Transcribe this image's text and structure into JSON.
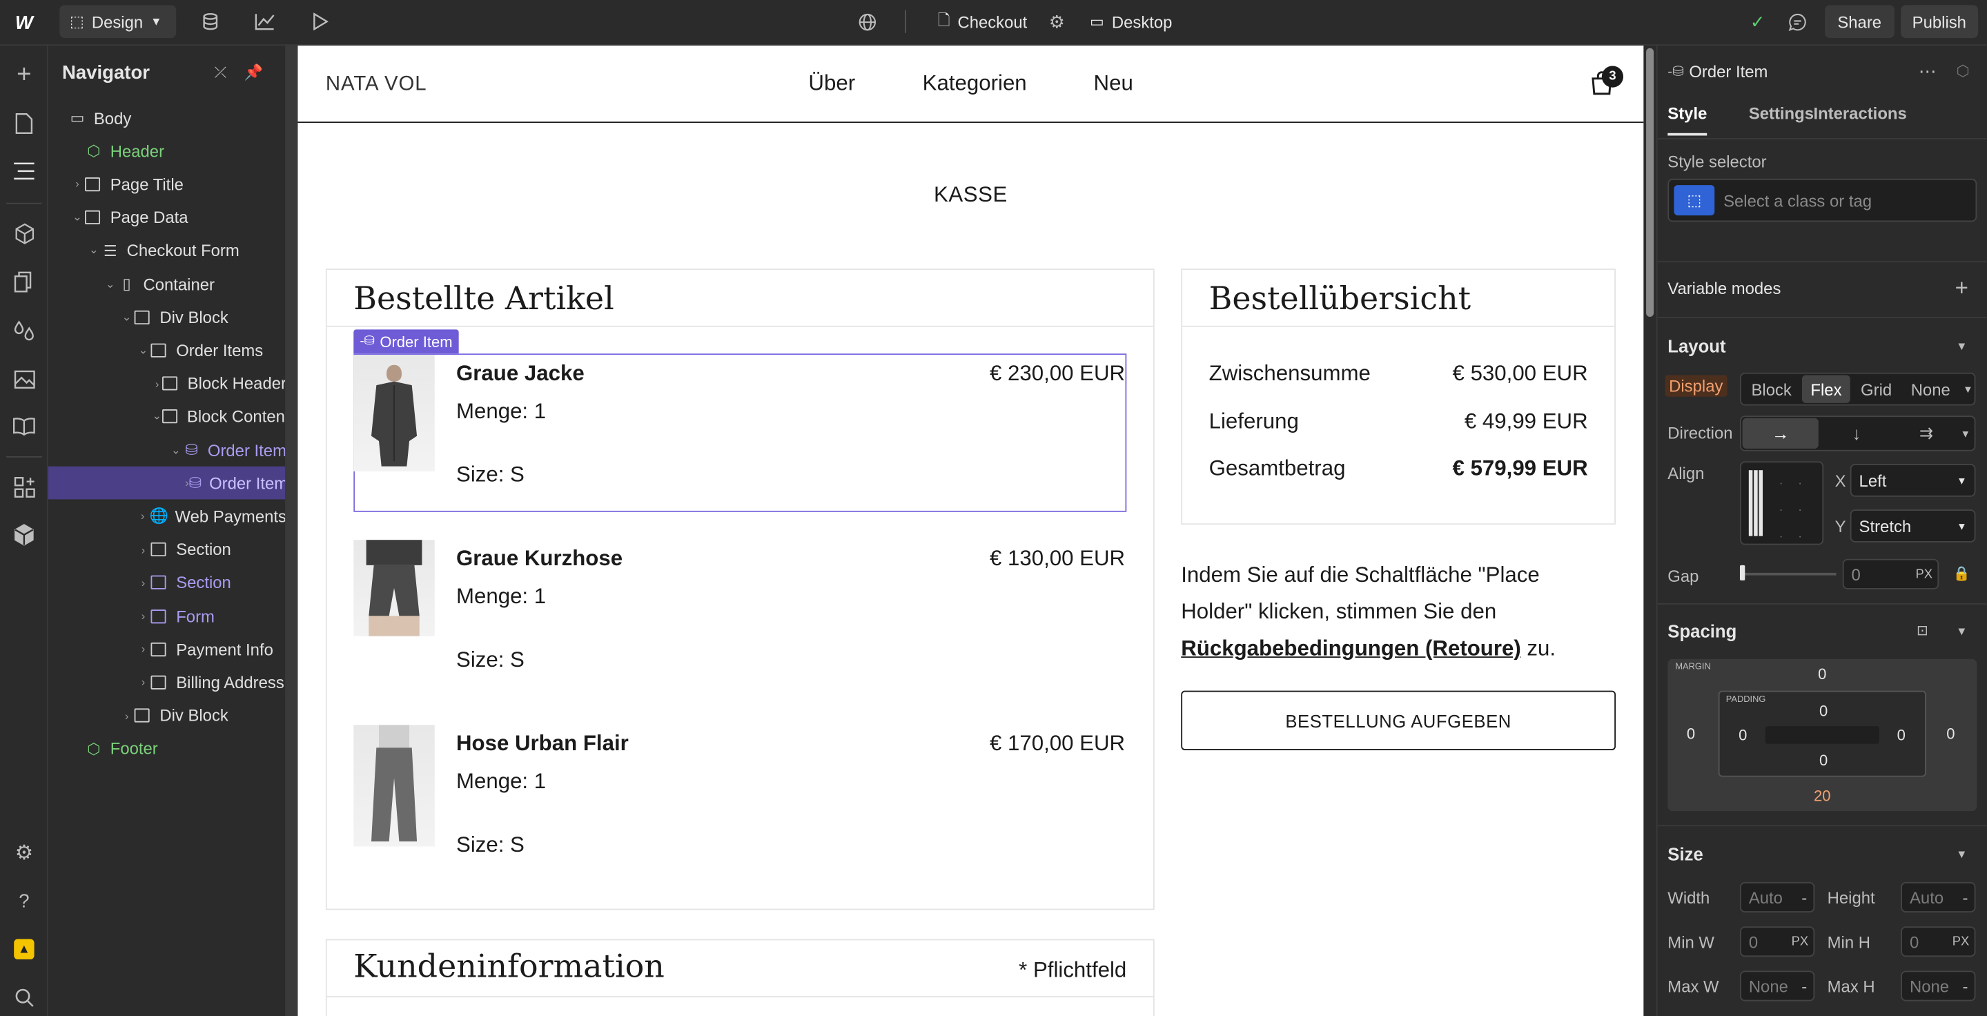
{
  "topbar": {
    "mode": "Design",
    "page": "Checkout",
    "breakpoint": "Desktop",
    "share": "Share",
    "publish": "Publish"
  },
  "navigator": {
    "title": "Navigator",
    "tree": [
      {
        "label": "Body",
        "icon": "body-icon",
        "color": "normal"
      },
      {
        "label": "Header",
        "icon": "component-icon",
        "color": "green"
      },
      {
        "label": "Page Title",
        "icon": "div-icon",
        "color": "normal"
      },
      {
        "label": "Page Data",
        "icon": "div-icon",
        "color": "normal"
      },
      {
        "label": "Checkout Form",
        "icon": "form-icon",
        "color": "normal"
      },
      {
        "label": "Container",
        "icon": "container-icon",
        "color": "normal"
      },
      {
        "label": "Div Block",
        "icon": "div-icon",
        "color": "normal"
      },
      {
        "label": "Order Items",
        "icon": "div-icon",
        "color": "normal"
      },
      {
        "label": "Block Header",
        "icon": "div-icon",
        "color": "normal"
      },
      {
        "label": "Block Content",
        "icon": "div-icon",
        "color": "normal"
      },
      {
        "label": "Order Item",
        "icon": "collection-icon",
        "color": "purple"
      },
      {
        "label": "Order Item",
        "icon": "collection-item-icon",
        "color": "purple"
      },
      {
        "label": "Web Payments",
        "icon": "globe-icon",
        "color": "normal"
      },
      {
        "label": "Section",
        "icon": "div-icon",
        "color": "normal"
      },
      {
        "label": "Section",
        "icon": "div-icon",
        "color": "purple"
      },
      {
        "label": "Form",
        "icon": "div-icon",
        "color": "purple"
      },
      {
        "label": "Payment Info",
        "icon": "div-icon",
        "color": "normal"
      },
      {
        "label": "Billing Address",
        "icon": "div-icon",
        "color": "normal"
      },
      {
        "label": "Div Block",
        "icon": "div-icon",
        "color": "normal"
      },
      {
        "label": "Footer",
        "icon": "component-icon",
        "color": "green"
      }
    ]
  },
  "site": {
    "brand": "NATA VOL",
    "nav": [
      "Über",
      "Kategorien",
      "Neu"
    ],
    "cart_count": "3",
    "page_heading": "KASSE",
    "selected_label": "Order Item",
    "ordered_title": "Bestellte Artikel",
    "items": [
      {
        "name": "Graue Jacke",
        "price": "€ 230,00 EUR",
        "qty": "Menge: 1",
        "size": "Size: S"
      },
      {
        "name": "Graue Kurzhose",
        "price": "€ 130,00 EUR",
        "qty": "Menge: 1",
        "size": "Size: S"
      },
      {
        "name": "Hose Urban Flair",
        "price": "€ 170,00 EUR",
        "qty": "Menge: 1",
        "size": "Size: S"
      }
    ],
    "summary_title": "Bestellübersicht",
    "summary": [
      {
        "label": "Zwischensumme",
        "value": "€ 530,00 EUR"
      },
      {
        "label": "Lieferung",
        "value": "€ 49,99 EUR"
      },
      {
        "label": "Gesamtbetrag",
        "value": "€ 579,99 EUR"
      }
    ],
    "terms_line1": "Indem Sie auf die Schaltfläche \"Place",
    "terms_line2": "Holder\" klicken, stimmen Sie den",
    "terms_link": "Rückgabebedingungen (Retoure)",
    "terms_end": " zu.",
    "order_button": "BESTELLUNG AUFGEBEN",
    "customer_title": "Kundeninformation",
    "required": "* Pflichtfeld"
  },
  "panel": {
    "element": "Order Item",
    "tabs": [
      "Style",
      "Settings",
      "Interactions"
    ],
    "style_selector_label": "Style selector",
    "style_selector_placeholder": "Select a class or tag",
    "variable_modes": "Variable modes",
    "layout": {
      "title": "Layout",
      "display_label": "Display",
      "display_options": [
        "Block",
        "Flex",
        "Grid",
        "None"
      ],
      "display_selected": "Flex",
      "direction_label": "Direction",
      "align_label": "Align",
      "align_x_label": "X",
      "align_x": "Left",
      "align_y_label": "Y",
      "align_y": "Stretch",
      "gap_label": "Gap",
      "gap_value": "0",
      "gap_unit": "PX"
    },
    "spacing": {
      "title": "Spacing",
      "margin_label": "MARGIN",
      "padding_label": "PADDING",
      "margin_top": "0",
      "margin_left": "0",
      "margin_right": "0",
      "margin_bottom": "20",
      "padding_top": "0",
      "padding_left": "0",
      "padding_right": "0",
      "padding_bottom": "0"
    },
    "size": {
      "title": "Size",
      "width_label": "Width",
      "width": "Auto",
      "height_label": "Height",
      "height": "Auto",
      "minw_label": "Min W",
      "minw": "0",
      "minw_unit": "PX",
      "minh_label": "Min H",
      "minh": "0",
      "minh_unit": "PX",
      "maxw_label": "Max W",
      "maxw": "None",
      "maxh_label": "Max H",
      "maxh": "None",
      "dash": "-"
    }
  }
}
